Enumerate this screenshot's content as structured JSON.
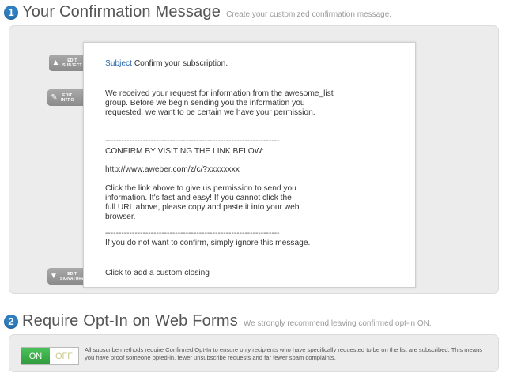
{
  "step1": {
    "number": "1",
    "title": "Your Confirmation Message",
    "subtitle": "Create your customized confirmation message."
  },
  "side_buttons": {
    "subject": {
      "line1": "EDIT",
      "line2": "SUBJECT",
      "icon": "arrow-up-icon"
    },
    "intro": {
      "line1": "EDIT",
      "line2": "INTRO",
      "icon": "pencil-icon"
    },
    "signature": {
      "line1": "EDIT",
      "line2": "SIGNATURE",
      "icon": "arrow-down-icon"
    }
  },
  "message": {
    "subject_label": "Subject",
    "subject_value": "Confirm your subscription.",
    "intro_lines": [
      "We received your request for information from the awesome_list",
      "group. Before we begin sending you the information you",
      "requested, we want to be certain we have your permission."
    ],
    "rule": "-----------------------------------------------------------------",
    "confirm_heading": "CONFIRM BY VISITING THE LINK BELOW:",
    "confirm_link": "http://www.aweber.com/z/c/?xxxxxxxx",
    "instructions_lines": [
      "Click the link above to give us permission to send you",
      "information. It's fast and easy! If you cannot click the",
      "full URL above, please copy and paste it into your web",
      "browser."
    ],
    "ignore_text": "If you do not want to confirm, simply ignore this message.",
    "closing_placeholder": "Click to add a custom closing"
  },
  "step2": {
    "number": "2",
    "title": "Require Opt-In on Web Forms",
    "subtitle": "We strongly recommend leaving confirmed opt-in ON."
  },
  "optin": {
    "on_label": "ON",
    "off_label": "OFF",
    "state": "on",
    "description": "All subscribe methods require Confirmed Opt-In to ensure only recipients who have specifically requested to be on the list are subscribed. This means you have proof someone opted-in, fewer unsubscribe requests and far fewer spam complaints."
  },
  "colors": {
    "accent_blue": "#2f7fc1",
    "toggle_on_green": "#3aaa48",
    "subject_label_blue": "#2466a8"
  }
}
